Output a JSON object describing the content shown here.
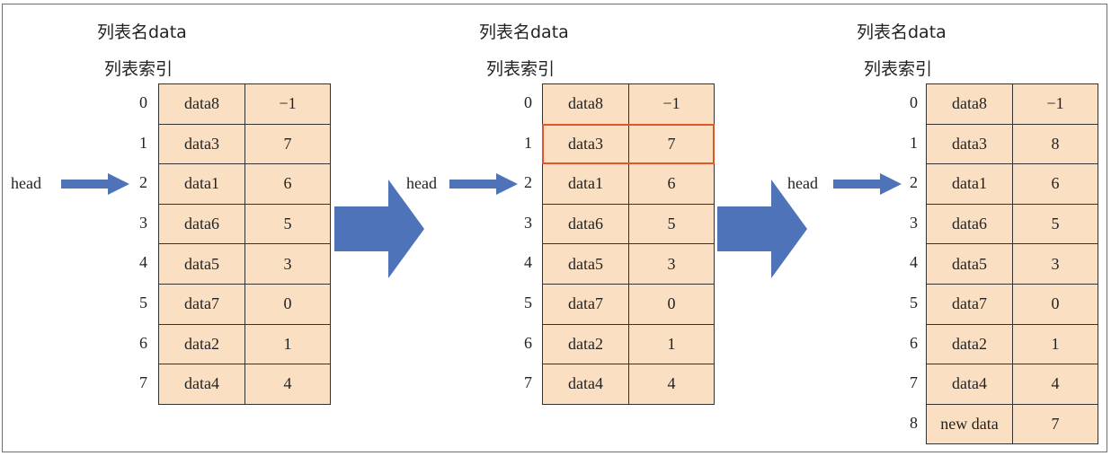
{
  "panels": [
    {
      "list_name": "列表名data",
      "list_index_label": "列表索引",
      "head_label": "head",
      "rows": [
        {
          "index": "0",
          "data": "data8",
          "next": "−1"
        },
        {
          "index": "1",
          "data": "data3",
          "next": "7"
        },
        {
          "index": "2",
          "data": "data1",
          "next": "6"
        },
        {
          "index": "3",
          "data": "data6",
          "next": "5"
        },
        {
          "index": "4",
          "data": "data5",
          "next": "3"
        },
        {
          "index": "5",
          "data": "data7",
          "next": "0"
        },
        {
          "index": "6",
          "data": "data2",
          "next": "1"
        },
        {
          "index": "7",
          "data": "data4",
          "next": "4"
        }
      ]
    },
    {
      "list_name": "列表名data",
      "list_index_label": "列表索引",
      "head_label": "head",
      "highlight_row": 1,
      "highlight_color": "#e0562a",
      "rows": [
        {
          "index": "0",
          "data": "data8",
          "next": "−1"
        },
        {
          "index": "1",
          "data": "data3",
          "next": "7"
        },
        {
          "index": "2",
          "data": "data1",
          "next": "6"
        },
        {
          "index": "3",
          "data": "data6",
          "next": "5"
        },
        {
          "index": "4",
          "data": "data5",
          "next": "3"
        },
        {
          "index": "5",
          "data": "data7",
          "next": "0"
        },
        {
          "index": "6",
          "data": "data2",
          "next": "1"
        },
        {
          "index": "7",
          "data": "data4",
          "next": "4"
        }
      ]
    },
    {
      "list_name": "列表名data",
      "list_index_label": "列表索引",
      "head_label": "head",
      "rows": [
        {
          "index": "0",
          "data": "data8",
          "next": "−1"
        },
        {
          "index": "1",
          "data": "data3",
          "next": "8"
        },
        {
          "index": "2",
          "data": "data1",
          "next": "6"
        },
        {
          "index": "3",
          "data": "data6",
          "next": "5"
        },
        {
          "index": "4",
          "data": "data5",
          "next": "3"
        },
        {
          "index": "5",
          "data": "data7",
          "next": "0"
        },
        {
          "index": "6",
          "data": "data2",
          "next": "1"
        },
        {
          "index": "7",
          "data": "data4",
          "next": "4"
        },
        {
          "index": "8",
          "data": "new data",
          "next": "7"
        }
      ]
    }
  ],
  "colors": {
    "cell_fill": "#fbdfc3",
    "arrow_fill": "#4f73b8",
    "highlight": "#e0562a"
  }
}
